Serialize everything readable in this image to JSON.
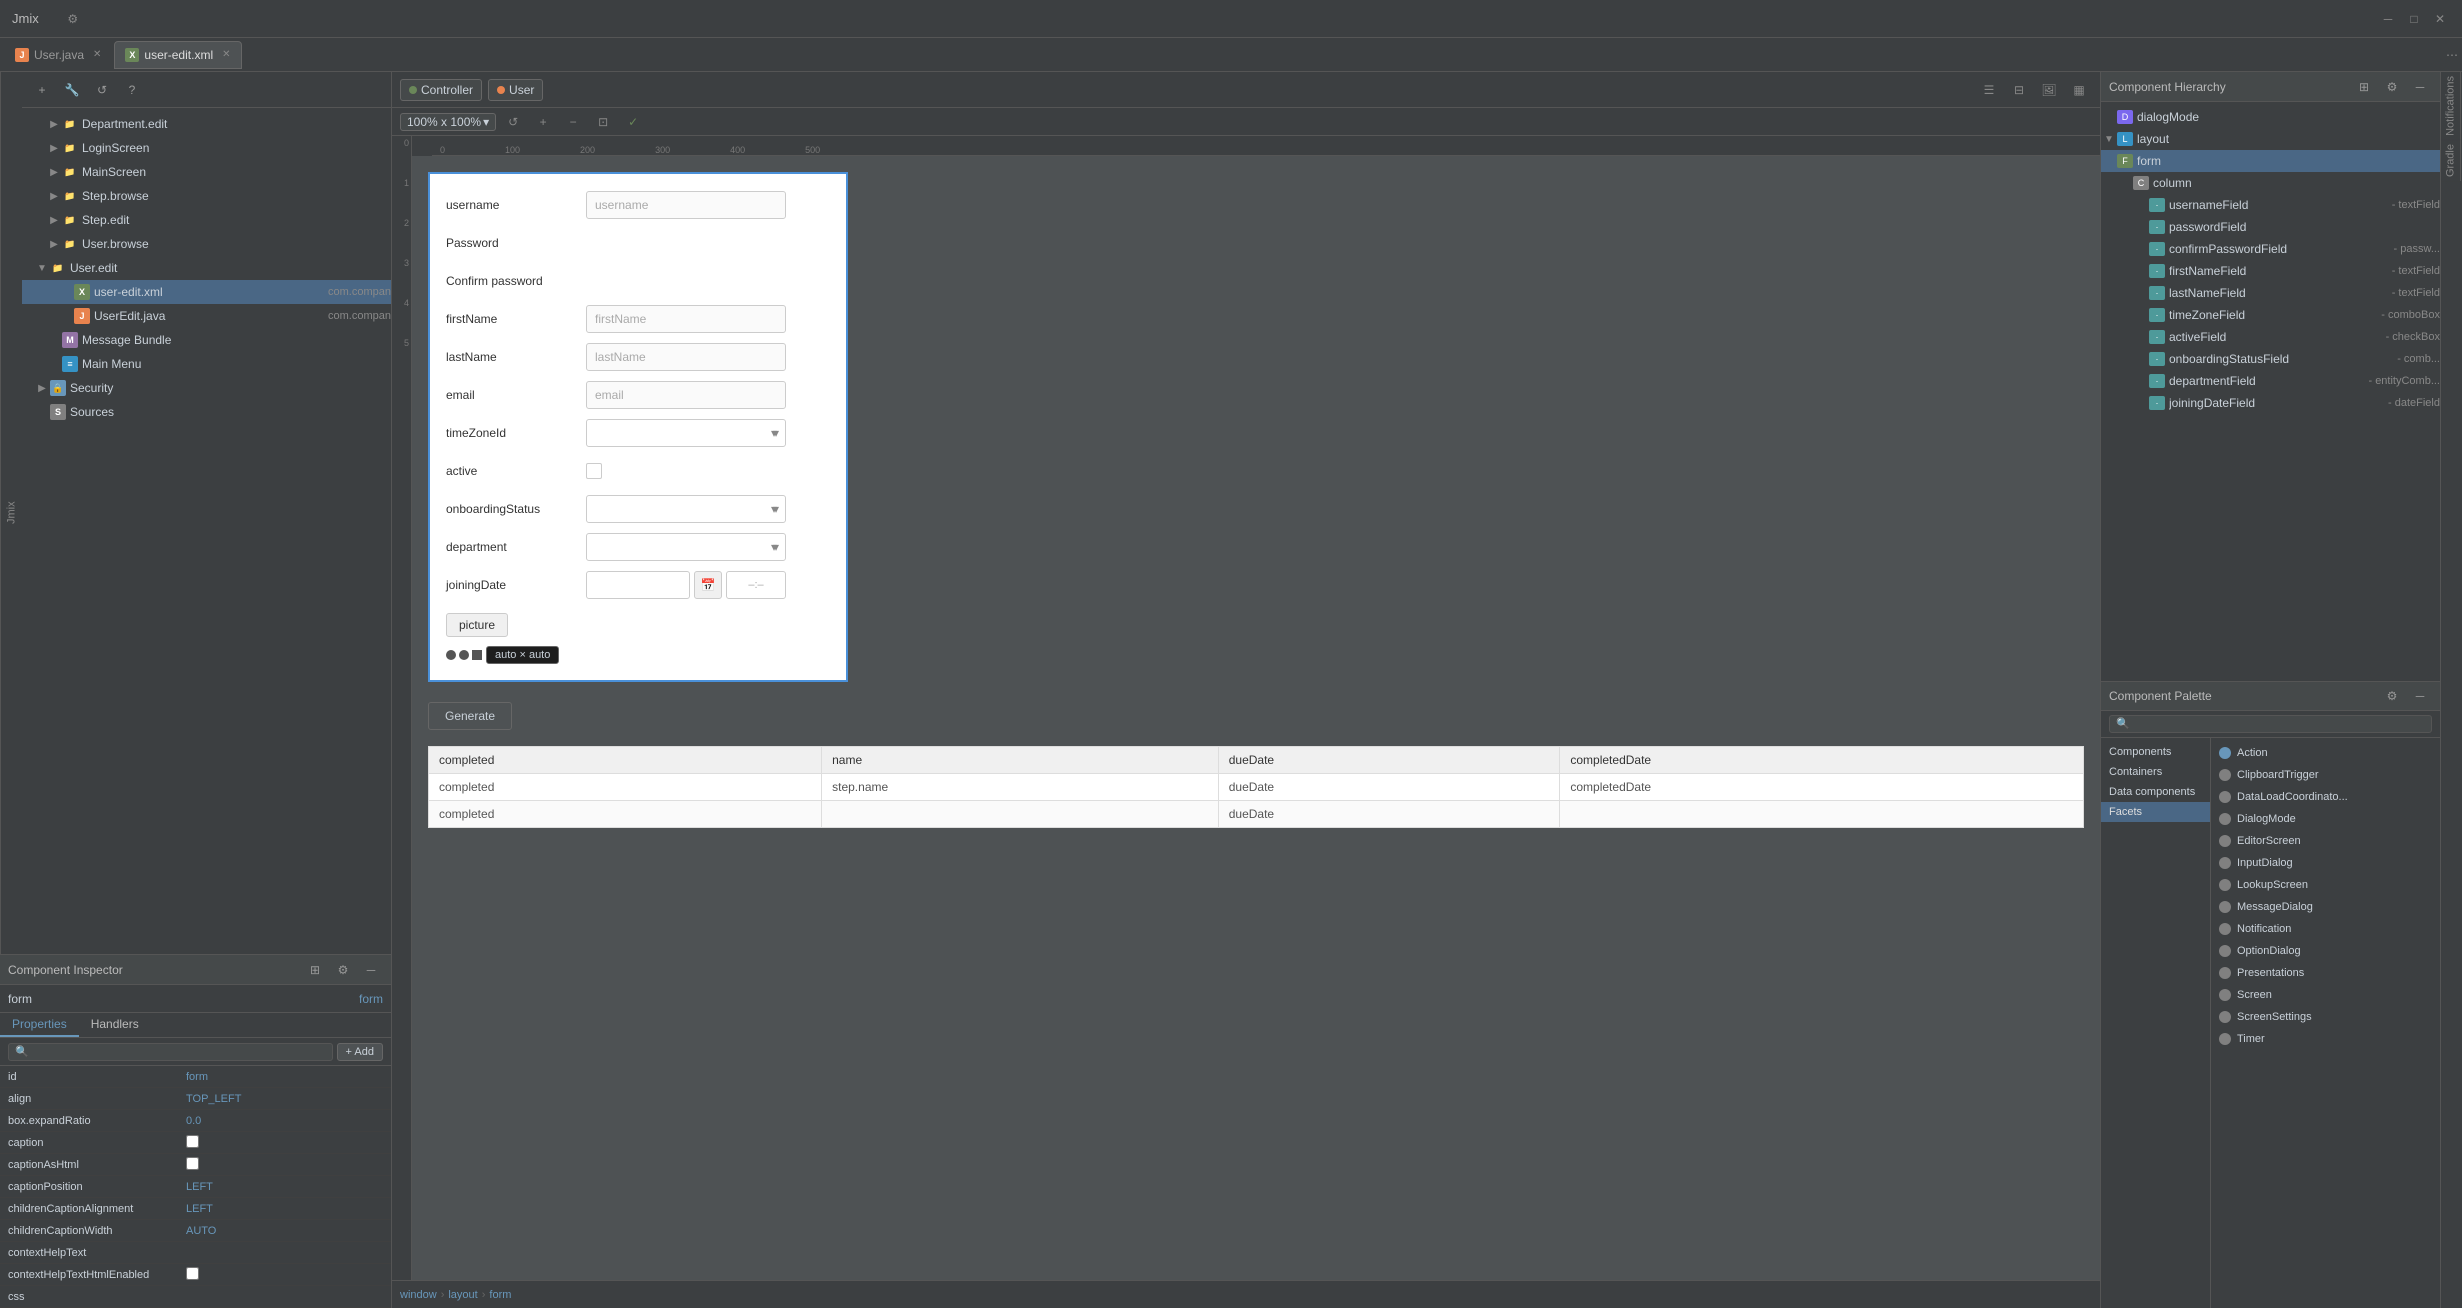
{
  "titleBar": {
    "title": "Jmix",
    "icons": [
      "settings",
      "close",
      "maximize"
    ]
  },
  "tabs": [
    {
      "id": "user-java",
      "label": "User.java",
      "type": "java",
      "active": false,
      "closeable": true
    },
    {
      "id": "user-edit-xml",
      "label": "user-edit.xml",
      "type": "xml",
      "active": true,
      "closeable": true
    }
  ],
  "toolbar": {
    "controller_label": "Controller",
    "user_label": "User",
    "zoom": "100% x 100%",
    "view_icons": [
      "grid",
      "split-h",
      "image",
      "image-alt",
      "more"
    ]
  },
  "leftPanel": {
    "title": "Jmix",
    "treeItems": [
      {
        "id": "department-edit",
        "label": "Department.edit",
        "type": "folder",
        "indent": 2,
        "hasArrow": true
      },
      {
        "id": "login-screen",
        "label": "LoginScreen",
        "type": "folder",
        "indent": 2,
        "hasArrow": true
      },
      {
        "id": "main-screen",
        "label": "MainScreen",
        "type": "folder",
        "indent": 2,
        "hasArrow": true
      },
      {
        "id": "step-browse",
        "label": "Step.browse",
        "type": "folder",
        "indent": 2,
        "hasArrow": true
      },
      {
        "id": "step-edit",
        "label": "Step.edit",
        "type": "folder",
        "indent": 2,
        "hasArrow": true
      },
      {
        "id": "user-browse",
        "label": "User.browse",
        "type": "folder",
        "indent": 2,
        "hasArrow": true
      },
      {
        "id": "user-edit",
        "label": "User.edit",
        "type": "folder",
        "indent": 1,
        "hasArrow": false,
        "expanded": true
      },
      {
        "id": "user-edit-xml-file",
        "label": "user-edit.xml",
        "type": "xml",
        "indent": 3,
        "sublabel": "com.compan",
        "selected": true
      },
      {
        "id": "useredit-java",
        "label": "UserEdit.java",
        "type": "java",
        "indent": 3,
        "sublabel": "com.compan"
      },
      {
        "id": "message-bundle",
        "label": "Message Bundle",
        "type": "bundle",
        "indent": 2
      },
      {
        "id": "main-menu",
        "label": "Main Menu",
        "type": "menu",
        "indent": 2
      },
      {
        "id": "security",
        "label": "Security",
        "type": "security",
        "indent": 1,
        "hasArrow": true
      },
      {
        "id": "sources",
        "label": "Sources",
        "type": "sources",
        "indent": 1
      }
    ]
  },
  "componentInspector": {
    "title": "Component Inspector",
    "formId": "form",
    "formIdValue": "form",
    "tabs": [
      "Properties",
      "Handlers"
    ],
    "searchPlaceholder": "",
    "addLabel": "+ Add",
    "properties": [
      {
        "name": "id",
        "value": "form",
        "type": "text"
      },
      {
        "name": "align",
        "value": "TOP_LEFT",
        "type": "text"
      },
      {
        "name": "box.expandRatio",
        "value": "0.0",
        "type": "text"
      },
      {
        "name": "caption",
        "value": "",
        "type": "checkbox"
      },
      {
        "name": "captionAsHtml",
        "value": false,
        "type": "checkbox"
      },
      {
        "name": "captionPosition",
        "value": "LEFT",
        "type": "text"
      },
      {
        "name": "childrenCaptionAlignment",
        "value": "LEFT",
        "type": "text"
      },
      {
        "name": "childrenCaptionWidth",
        "value": "AUTO",
        "type": "text"
      },
      {
        "name": "contextHelpText",
        "value": "",
        "type": "text"
      },
      {
        "name": "contextHelpTextHtmlEnabled",
        "value": false,
        "type": "checkbox"
      },
      {
        "name": "css",
        "value": "",
        "type": "text"
      }
    ]
  },
  "canvas": {
    "zoom": "100% x 100%",
    "rulerMarks": [
      "0",
      "100",
      "200",
      "300",
      "400",
      "500"
    ],
    "rulerMarksV": [
      "0",
      "1",
      "2",
      "3",
      "4",
      "5"
    ],
    "form": {
      "fields": [
        {
          "label": "username",
          "type": "input",
          "placeholder": "username"
        },
        {
          "label": "Password",
          "type": "password"
        },
        {
          "label": "Confirm password",
          "type": "password"
        },
        {
          "label": "firstName",
          "type": "input",
          "placeholder": "firstName"
        },
        {
          "label": "lastName",
          "type": "input",
          "placeholder": "lastName"
        },
        {
          "label": "email",
          "type": "input",
          "placeholder": "email"
        },
        {
          "label": "timeZoneId",
          "type": "select"
        },
        {
          "label": "active",
          "type": "checkbox"
        },
        {
          "label": "onboardingStatus",
          "type": "select"
        },
        {
          "label": "department",
          "type": "select"
        },
        {
          "label": "joiningDate",
          "type": "date"
        }
      ],
      "pictureLabel": "picture"
    },
    "tooltip": "auto × auto",
    "generateLabel": "Generate",
    "tableHeaders": [
      "completed",
      "name",
      "dueDate",
      "completedDate"
    ],
    "tableRows": [
      [
        "completed",
        "step.name",
        "dueDate",
        "completedDate"
      ],
      [
        "completed",
        "",
        "dueDate",
        ""
      ]
    ]
  },
  "breadcrumb": {
    "items": [
      "window",
      "layout",
      "form"
    ]
  },
  "componentHierarchy": {
    "title": "Component Hierarchy",
    "items": [
      {
        "id": "dialogMode",
        "label": "dialogMode",
        "type": "dialog",
        "indent": 0,
        "hasArrow": false
      },
      {
        "id": "layout",
        "label": "layout",
        "type": "layout",
        "indent": 1,
        "hasArrow": false,
        "expanded": true
      },
      {
        "id": "form",
        "label": "form",
        "type": "form",
        "indent": 2,
        "hasArrow": false,
        "expanded": true,
        "selected": true
      },
      {
        "id": "column",
        "label": "column",
        "type": "col",
        "indent": 3,
        "hasArrow": true,
        "expanded": true
      },
      {
        "id": "usernameField",
        "label": "usernameField",
        "sublabel": "- textField",
        "type": "field",
        "indent": 4
      },
      {
        "id": "passwordField",
        "label": "passwordField",
        "sublabel": "",
        "type": "field",
        "indent": 4
      },
      {
        "id": "confirmPasswordField",
        "label": "confirmPasswordField",
        "sublabel": "- passw...",
        "type": "field",
        "indent": 4
      },
      {
        "id": "firstNameField",
        "label": "firstNameField",
        "sublabel": "- textField",
        "type": "field",
        "indent": 4
      },
      {
        "id": "lastNameField",
        "label": "lastNameField",
        "sublabel": "- textField",
        "type": "field",
        "indent": 4
      },
      {
        "id": "timeZoneField",
        "label": "timeZoneField",
        "sublabel": "- comboBox",
        "type": "field",
        "indent": 4
      },
      {
        "id": "activeField",
        "label": "activeField",
        "sublabel": "- checkBox",
        "type": "field",
        "indent": 4
      },
      {
        "id": "onboardingStatusField",
        "label": "onboardingStatusField",
        "sublabel": "- comb...",
        "type": "field",
        "indent": 4
      },
      {
        "id": "departmentField",
        "label": "departmentField",
        "sublabel": "- entityComb...",
        "type": "field",
        "indent": 4
      },
      {
        "id": "joiningDateField",
        "label": "joiningDateField",
        "sublabel": "- dateField",
        "type": "field",
        "indent": 4
      }
    ]
  },
  "componentPalette": {
    "title": "Component Palette",
    "searchPlaceholder": "🔍",
    "categories": [
      "Components",
      "Containers",
      "Data components",
      "Facets"
    ],
    "selectedCategory": "Facets",
    "items": [
      {
        "label": "Action",
        "type": "action"
      },
      {
        "label": "ClipboardTrigger",
        "type": "other"
      },
      {
        "label": "DataLoadCoordinato...",
        "type": "other"
      },
      {
        "label": "DialogMode",
        "type": "other"
      },
      {
        "label": "EditorScreen",
        "type": "other"
      },
      {
        "label": "InputDialog",
        "type": "other"
      },
      {
        "label": "LookupScreen",
        "type": "other"
      },
      {
        "label": "MessageDialog",
        "type": "other"
      },
      {
        "label": "Notification",
        "type": "other"
      },
      {
        "label": "OptionDialog",
        "type": "other"
      },
      {
        "label": "Presentations",
        "type": "other"
      },
      {
        "label": "Screen",
        "type": "other"
      },
      {
        "label": "ScreenSettings",
        "type": "other"
      },
      {
        "label": "Timer",
        "type": "other"
      }
    ]
  },
  "verticalLabels": {
    "jmix": "Jmix",
    "notifications": "Notifications",
    "gradle": "Gradle"
  }
}
